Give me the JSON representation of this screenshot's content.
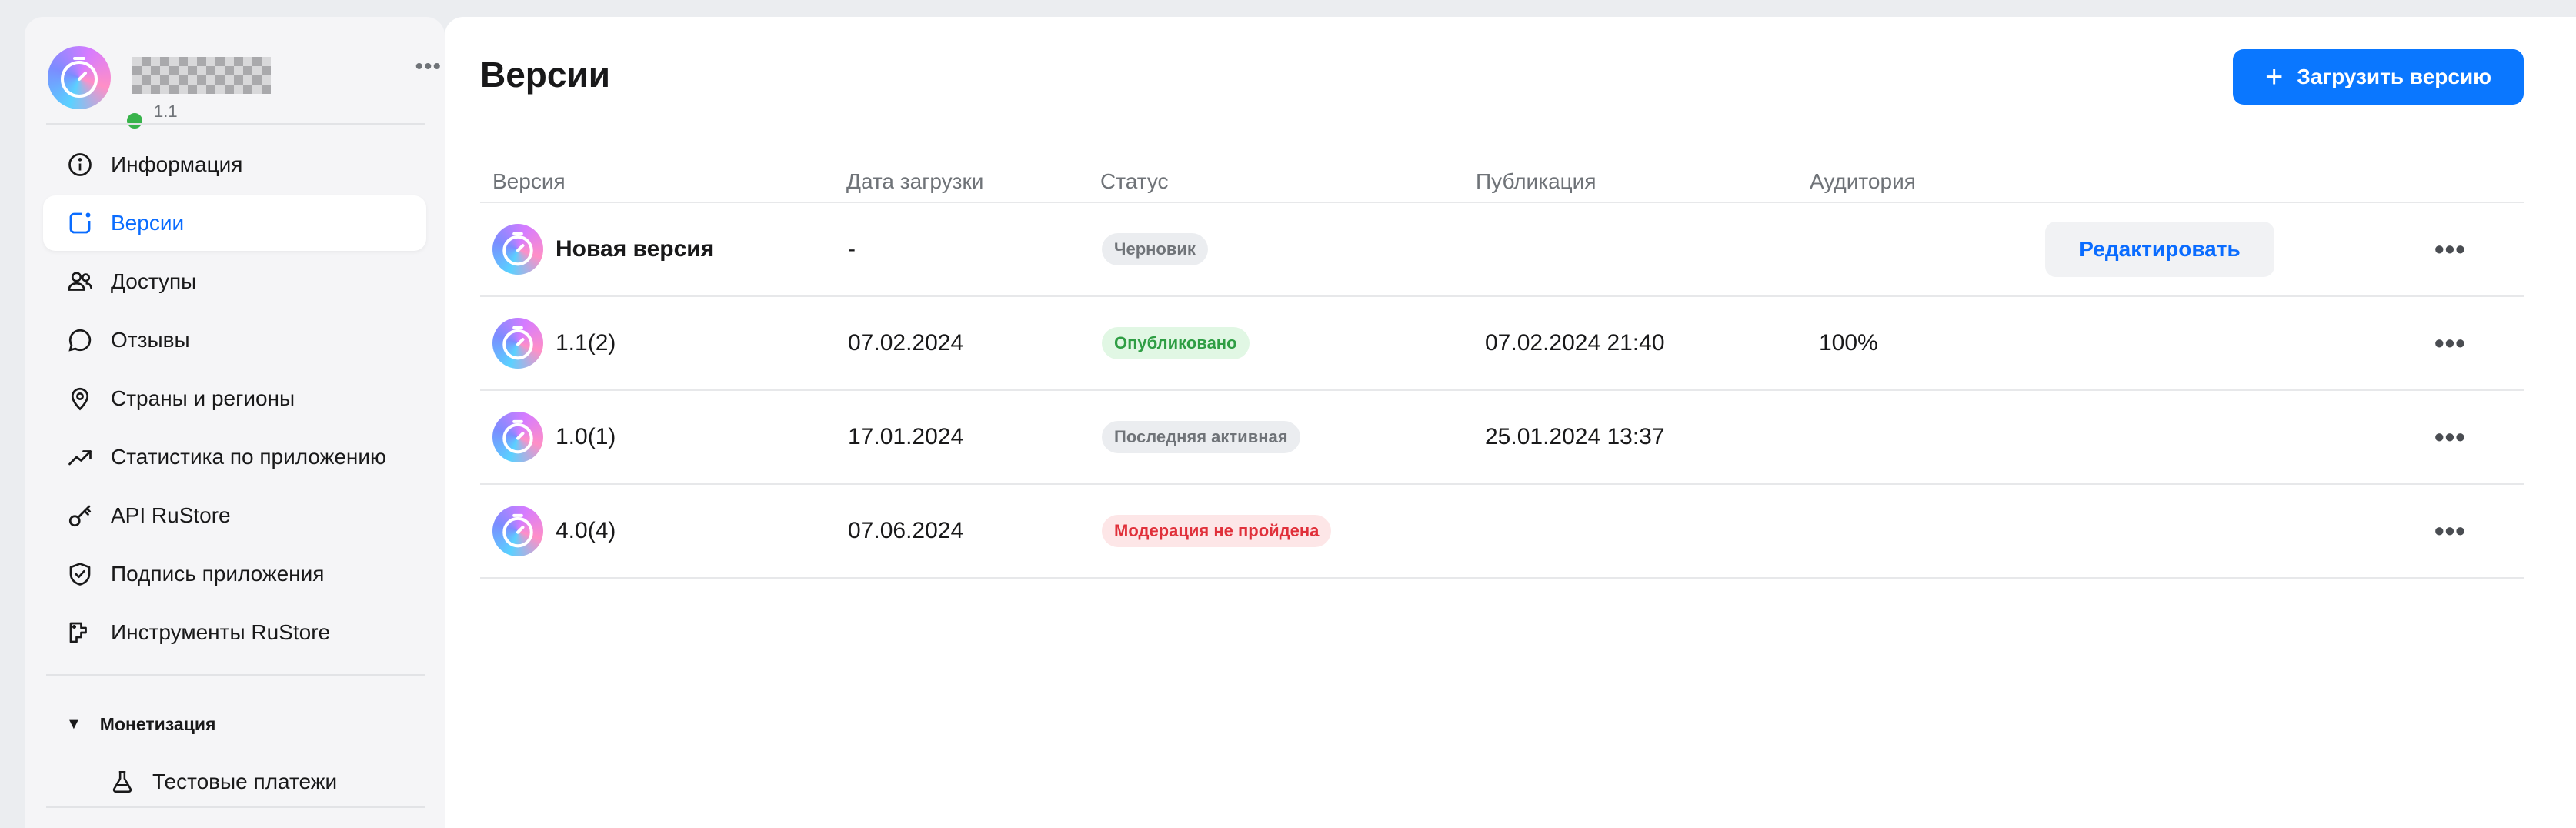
{
  "app": {
    "version": "1.1",
    "more_label": "•••"
  },
  "sidebar": {
    "items": [
      {
        "label": "Информация",
        "icon": "info-icon"
      },
      {
        "label": "Версии",
        "icon": "versions-icon",
        "active": true
      },
      {
        "label": "Доступы",
        "icon": "users-icon"
      },
      {
        "label": "Отзывы",
        "icon": "chat-icon"
      },
      {
        "label": "Страны и регионы",
        "icon": "location-icon"
      },
      {
        "label": "Статистика по приложению",
        "icon": "trend-icon"
      },
      {
        "label": "API RuStore",
        "icon": "key-icon"
      },
      {
        "label": "Подпись приложения",
        "icon": "shield-icon"
      },
      {
        "label": "Инструменты RuStore",
        "icon": "tools-icon"
      }
    ],
    "monetization": {
      "title": "Монетизация",
      "toggle": "▼",
      "items": [
        {
          "label": "Тестовые платежи",
          "icon": "flask-icon"
        }
      ]
    }
  },
  "main": {
    "title": "Версии",
    "upload_button": {
      "label": "Загрузить версию",
      "icon": "+"
    },
    "table": {
      "headers": {
        "version": "Версия",
        "upload_date": "Дата загрузки",
        "status": "Статус",
        "publication": "Публикация",
        "audience": "Аудитория"
      },
      "rows": [
        {
          "name": "Новая версия",
          "upload_date": "-",
          "status": "Черновик",
          "status_kind": "grey",
          "publication": "",
          "audience": "",
          "action": "Редактировать",
          "more": "•••"
        },
        {
          "name": "1.1(2)",
          "upload_date": "07.02.2024",
          "status": "Опубликовано",
          "status_kind": "green",
          "publication": "07.02.2024 21:40",
          "audience": "100%",
          "more": "•••"
        },
        {
          "name": "1.0(1)",
          "upload_date": "17.01.2024",
          "status": "Последняя активная",
          "status_kind": "grey",
          "publication": "25.01.2024 13:37",
          "audience": "",
          "more": "•••"
        },
        {
          "name": "4.0(4)",
          "upload_date": "07.06.2024",
          "status": "Модерация не пройдена",
          "status_kind": "red",
          "publication": "",
          "audience": "",
          "more": "•••"
        }
      ]
    }
  },
  "colors": {
    "accent": "#0a77ff",
    "active_text": "#0a6cff",
    "online": "#38b34b",
    "success": "#2f9e44",
    "danger": "#e0303a"
  }
}
